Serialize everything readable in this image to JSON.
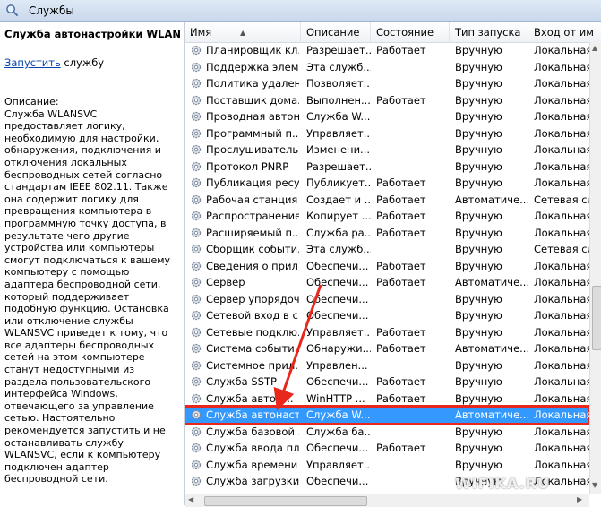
{
  "window": {
    "title": "Службы"
  },
  "left_pane": {
    "service_title": "Служба автонастройки WLAN",
    "start_link": "Запустить",
    "start_suffix": " службу",
    "description_label": "Описание:",
    "description": "Служба WLANSVC предоставляет логику, необходимую для настройки, обнаружения, подключения и отключения локальных беспроводных сетей согласно стандартам IEEE 802.11. Также она содержит логику для превращения компьютера в программную точку доступа, в результате чего другие устройства или компьютеры смогут подключаться к вашему компьютеру с помощью адаптера беспроводной сети, который поддерживает подобную функцию. Остановка или отключение службы WLANSVC приведет к тому, что все адаптеры беспроводных сетей на этом компьютере станут недоступными из раздела пользовательского интерфейса Windows, отвечающего за управление сетью. Настоятельно рекомендуется запустить и не останавливать службу WLANSVC, если к компьютеру подключен адаптер беспроводной сети."
  },
  "columns": [
    "Имя",
    "Описание",
    "Состояние",
    "Тип запуска",
    "Вход от им"
  ],
  "rows": [
    {
      "name": "Планировщик кл...",
      "desc": "Разрешает...",
      "state": "Работает",
      "start": "Вручную",
      "logon": "Локальная"
    },
    {
      "name": "Поддержка элем...",
      "desc": "Эта служб...",
      "state": "",
      "start": "Вручную",
      "logon": "Локальная"
    },
    {
      "name": "Политика удален...",
      "desc": "Позволяет...",
      "state": "",
      "start": "Вручную",
      "logon": "Локальная"
    },
    {
      "name": "Поставщик дома...",
      "desc": "Выполнен...",
      "state": "Работает",
      "start": "Вручную",
      "logon": "Локальная"
    },
    {
      "name": "Проводная автон...",
      "desc": "Служба W...",
      "state": "",
      "start": "Вручную",
      "logon": "Локальная"
    },
    {
      "name": "Программный п...",
      "desc": "Управляет...",
      "state": "",
      "start": "Вручную",
      "logon": "Локальная"
    },
    {
      "name": "Прослушиватель...",
      "desc": "Изменени...",
      "state": "",
      "start": "Вручную",
      "logon": "Локальная"
    },
    {
      "name": "Протокол PNRP",
      "desc": "Разрешает...",
      "state": "",
      "start": "Вручную",
      "logon": "Локальная"
    },
    {
      "name": "Публикация ресу...",
      "desc": "Публикует...",
      "state": "Работает",
      "start": "Вручную",
      "logon": "Локальная"
    },
    {
      "name": "Рабочая станция",
      "desc": "Создает и ...",
      "state": "Работает",
      "start": "Автоматиче...",
      "logon": "Сетевая сл"
    },
    {
      "name": "Распространение...",
      "desc": "Копирует ...",
      "state": "Работает",
      "start": "Вручную",
      "logon": "Локальная"
    },
    {
      "name": "Расширяемый п...",
      "desc": "Служба ра...",
      "state": "Работает",
      "start": "Вручную",
      "logon": "Локальная"
    },
    {
      "name": "Сборщик событи...",
      "desc": "Эта служб...",
      "state": "",
      "start": "Вручную",
      "logon": "Сетевая сл"
    },
    {
      "name": "Сведения о прил...",
      "desc": "Обеспечи...",
      "state": "Работает",
      "start": "Вручную",
      "logon": "Локальная"
    },
    {
      "name": "Сервер",
      "desc": "Обеспечи...",
      "state": "Работает",
      "start": "Автоматиче...",
      "logon": "Локальная"
    },
    {
      "name": "Сервер упорядоч...",
      "desc": "Обеспечи...",
      "state": "",
      "start": "Вручную",
      "logon": "Локальная"
    },
    {
      "name": "Сетевой вход в с...",
      "desc": "Обеспечи...",
      "state": "",
      "start": "Вручную",
      "logon": "Локальная"
    },
    {
      "name": "Сетевые подклю...",
      "desc": "Управляет...",
      "state": "Работает",
      "start": "Вручную",
      "logon": "Локальная"
    },
    {
      "name": "Система событи...",
      "desc": "Обнаружи...",
      "state": "Работает",
      "start": "Автоматиче...",
      "logon": "Локальная"
    },
    {
      "name": "Системное прил...",
      "desc": "Управлен...",
      "state": "",
      "start": "Вручную",
      "logon": "Локальная"
    },
    {
      "name": "Служба SSTP",
      "desc": "Обеспечи...",
      "state": "Работает",
      "start": "Вручную",
      "logon": "Локальная"
    },
    {
      "name": "Служба автом...",
      "desc": "WinHTTP ...",
      "state": "Работает",
      "start": "Вручную",
      "logon": "Локальная"
    },
    {
      "name": "Служба автонаст...",
      "desc": "Служба W...",
      "state": "",
      "start": "Автоматиче...",
      "logon": "Локальная",
      "selected": true
    },
    {
      "name": "Служба базовой ...",
      "desc": "Служба ба...",
      "state": "",
      "start": "Вручную",
      "logon": "Локальная"
    },
    {
      "name": "Служба ввода пл...",
      "desc": "Обеспечи...",
      "state": "Работает",
      "start": "Вручную",
      "logon": "Локальная"
    },
    {
      "name": "Служба времени ...",
      "desc": "Управляет...",
      "state": "",
      "start": "Вручную",
      "logon": "Локальная"
    },
    {
      "name": "Служба загрузки ...",
      "desc": "Обеспечи...",
      "state": "",
      "start": "Вручную",
      "logon": "Локальная"
    }
  ],
  "watermark": "WIFIKA.RU",
  "colors": {
    "selection": "#3399ff",
    "highlight_frame": "#e8281d",
    "arrow": "#e8281d",
    "link": "#0645ad"
  }
}
